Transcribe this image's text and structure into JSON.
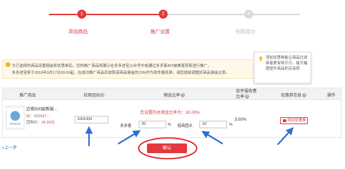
{
  "steps": [
    {
      "index": "1",
      "label": "添加商品",
      "state": "done"
    },
    {
      "index": "2",
      "label": "推广设置",
      "state": "active"
    },
    {
      "index": "3",
      "label": "创建成功",
      "state": "pending"
    }
  ],
  "notice": {
    "line1": "为已选择的商品设置佣金和优惠券后，您的推广商品将展示在多多进宝公众号中或通过多多客API被推客获取进行推广。",
    "line2": "多多进宝将于2018年9月17日00:00起，在成功推广商品后收取该商品佣金的10%作为软件服务费，请您提前调整好商品佣金比率。"
  },
  "tooltip": {
    "text": "添加优惠券能让商品过滤商者更有吸引力，能大幅度提升商品的买采转"
  },
  "table": {
    "headers": {
      "product": "推广商品",
      "group_id": "拉商团长ID",
      "commission": "佣金比率",
      "service_fee": "软件服务费比率",
      "coupon": "优惠券信息",
      "action": "操作"
    },
    "row": {
      "product_name": "迈夜500层新破...",
      "product_id_label": "ID：",
      "product_id": "422027...",
      "price_label": "团购价：",
      "price": "26.90元",
      "group_id_value": "1001434",
      "commission_summary": "您设置的总佣金比率为：30.00%",
      "duoduo_label": "多多客",
      "duoduo_value": "20",
      "percent": "%",
      "leader_label": "招商团长",
      "leader_value": "10",
      "service_fee_value": "3.00%",
      "coupon_button": "添加优惠券"
    }
  },
  "confirm_button": "确认",
  "back_link": "<上一步",
  "colors": {
    "accent": "#e4393c",
    "annotation_blue": "#2f6fd1",
    "annotation_red": "#e02020"
  }
}
